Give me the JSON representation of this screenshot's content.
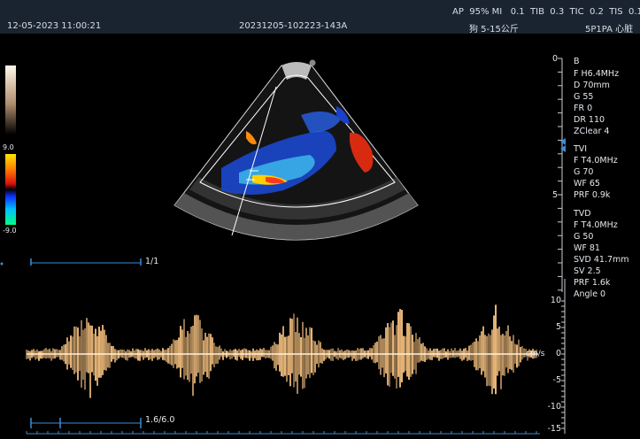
{
  "header": {
    "datetime": "12-05-2023 11:00:21",
    "exam_id": "20231205-102223-143A",
    "patient": "狗 5-15公斤",
    "probe_preset": "5P1PA 心脏",
    "indices": "AP  95% MI   0.1  TIB  0.3  TIC  0.2  TIS  0.1"
  },
  "grayscale_bar": {
    "top_color": "#fff7ea",
    "bottom_color": "#000000"
  },
  "color_bar": {
    "max_label": "9.0",
    "min_label": "-9.0"
  },
  "b_mode": {
    "title": "B",
    "freq": "F H6.4MHz",
    "depth": "D 70mm",
    "gain": "G 55",
    "frame_rate": "FR 0",
    "dynamic_range": "DR 110",
    "zclear": "ZClear 4"
  },
  "tvi": {
    "title": "TVI",
    "freq": "F T4.0MHz",
    "gain": "G 70",
    "wall_filter": "WF 65",
    "prf": "PRF 0.9k"
  },
  "tvd": {
    "title": "TVD",
    "freq": "F T4.0MHz",
    "gain": "G 50",
    "wall_filter": "WF 81",
    "svd": "SVD 41.7mm",
    "sv": "SV 2.5",
    "prf": "PRF 1.6k",
    "angle": "Angle 0"
  },
  "depth_scale": {
    "top": "0",
    "mid": "5"
  },
  "velocity_scale": {
    "unit": "cm/s",
    "ticks": [
      "10",
      "5",
      "0",
      "-5",
      "-10",
      "-15"
    ]
  },
  "cine_top": "1/1",
  "cine_bottom": "1.6/6.0",
  "colors": {
    "accent": "#3a8ed8",
    "doppler": "#f2c98a"
  }
}
